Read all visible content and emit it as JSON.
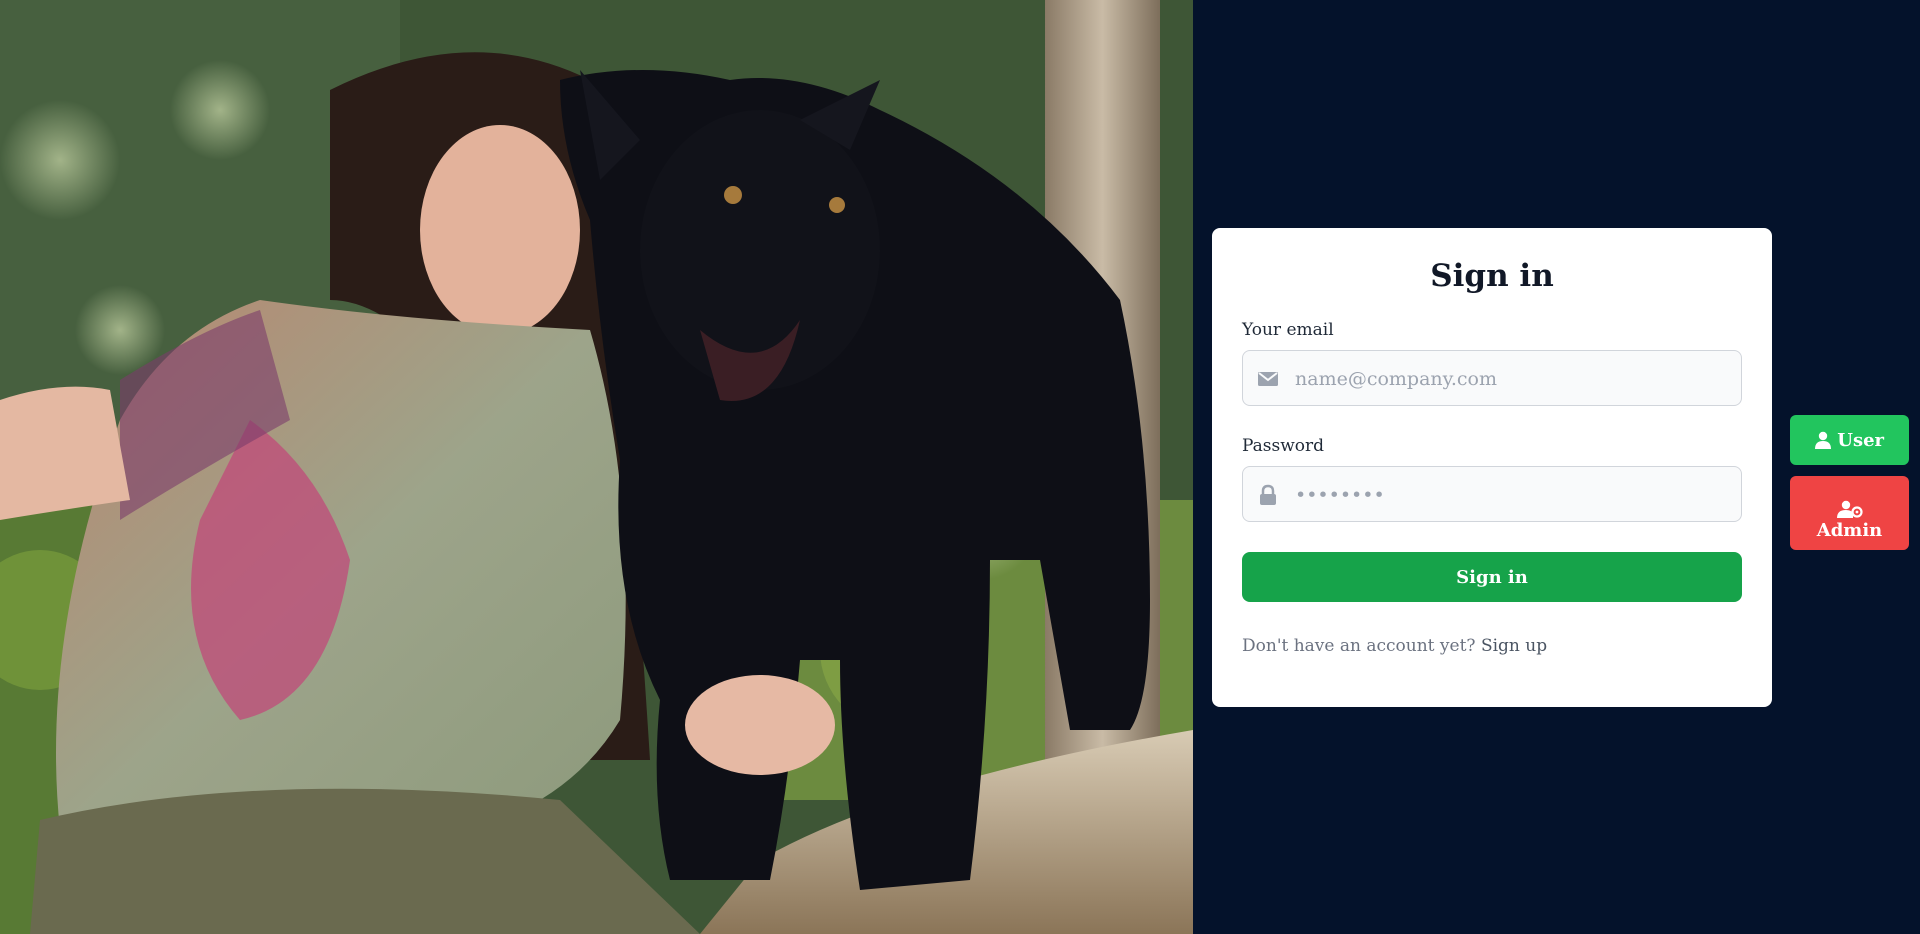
{
  "signin": {
    "title": "Sign in",
    "email_label": "Your email",
    "email_placeholder": "name@company.com",
    "email_icon": "envelope-icon",
    "password_label": "Password",
    "password_value": "••••••••",
    "password_icon": "lock-icon",
    "submit_label": "Sign in",
    "signup_prompt": "Don't have an account yet?",
    "signup_link": "Sign up"
  },
  "roles": {
    "user_label": "User",
    "user_icon": "user-icon",
    "admin_label": "Admin",
    "admin_icon": "user-gear-icon"
  },
  "colors": {
    "page_background": "#04122b",
    "card_background": "#ffffff",
    "submit_button": "#16a34a",
    "user_button": "#22c55e",
    "admin_button": "#ef4444"
  },
  "hero_image": {
    "icon": "photo-girl-with-black-panther"
  }
}
